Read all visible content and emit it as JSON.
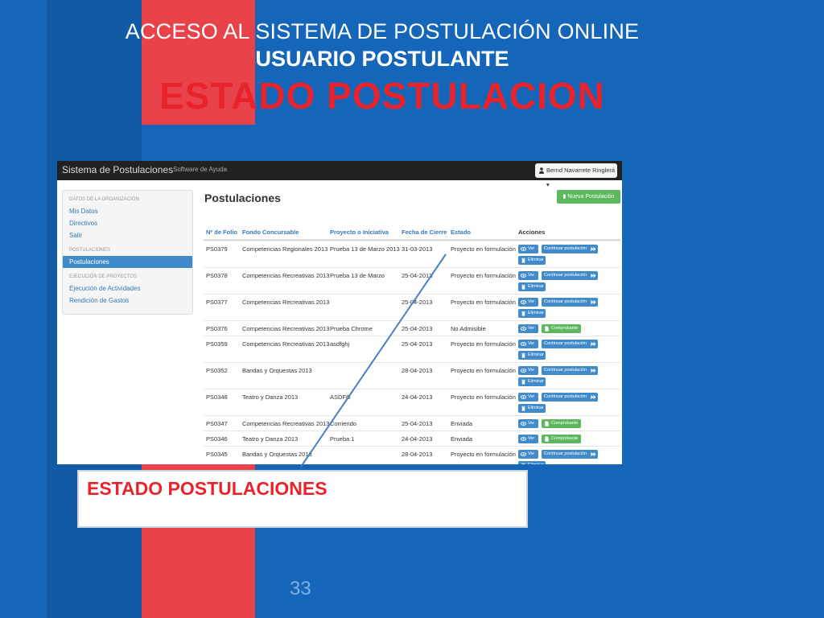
{
  "slide": {
    "title_line1": "ACCESO AL SISTEMA DE POSTULACIÓN ONLINE",
    "title_line2": "USUARIO POSTULANTE",
    "title_line3": "ESTADO POSTULACION",
    "callout": "ESTADO POSTULACIONES",
    "page_number": "33"
  },
  "colors": {
    "slide_bg": "#1565b8",
    "red_band": "#e8434a",
    "title_red": "#e8232b",
    "navbar": "#222222",
    "link_blue": "#337ab7",
    "btn_primary": "#428bca",
    "btn_success": "#5cb85c"
  },
  "app": {
    "brand": "Sistema de Postulaciones",
    "help": "Software de Ayuda",
    "user": "Bernd Navarrete Ringlerá",
    "sidebar": {
      "section1": "DATOS DE LA ORGANIZACIÓN",
      "item_mis_datos": "Mis Datos",
      "item_directivos": "Directivos",
      "item_salir": "Salir",
      "section2": "POSTULACIONES",
      "item_postulaciones": "Postulaciones",
      "section3": "EJECUCIÓN DE PROYECTOS",
      "item_ejecucion": "Ejecución de Actividades",
      "item_rendicion": "Rendición de Gastos"
    },
    "content_title": "Postulaciones",
    "new_button": "Nueva Postulación",
    "table": {
      "headers": {
        "folio": "Nº de Folio",
        "fondo": "Fondo Concursable",
        "proyecto": "Proyecto o Iniciativa",
        "fecha": "Fecha de Cierre",
        "estado": "Estado",
        "acciones": "Acciones"
      },
      "labels": {
        "ver": "Ver",
        "continuar": "Continuar postulación",
        "eliminar": "Eliminar",
        "comprobante": "Comprobante"
      },
      "rows": [
        {
          "folio": "PS0379",
          "fondo": "Competencias Regionales 2013",
          "proyecto": "Prueba 13 de Marzo 2013",
          "fecha": "31-03-2013",
          "estado": "Proyecto en formulación"
        },
        {
          "folio": "PS0378",
          "fondo": "Competencias Recreativas 2013",
          "proyecto": "Prueba 13 de Marzo",
          "fecha": "25-04-2013",
          "estado": "Proyecto en formulación"
        },
        {
          "folio": "PS0377",
          "fondo": "Competencias Recreativas 2013",
          "proyecto": "",
          "fecha": "25-04-2013",
          "estado": "Proyecto en formulación"
        },
        {
          "folio": "PS0376",
          "fondo": "Competencias Recreativas 2013",
          "proyecto": "Prueba Chrome",
          "fecha": "25-04-2013",
          "estado": "No Admisible"
        },
        {
          "folio": "PS0359",
          "fondo": "Competencias Recreativas 2013",
          "proyecto": "asdfghj",
          "fecha": "25-04-2013",
          "estado": "Proyecto en formulación"
        },
        {
          "folio": "PS0352",
          "fondo": "Bandas y Orquestas 2013",
          "proyecto": "",
          "fecha": "28-04-2013",
          "estado": "Proyecto en formulación"
        },
        {
          "folio": "PS0348",
          "fondo": "Teatro y Danza 2013",
          "proyecto": "ASDFG",
          "fecha": "24-04-2013",
          "estado": "Proyecto en formulación"
        },
        {
          "folio": "PS0347",
          "fondo": "Competencias Recreativas 2013",
          "proyecto": "Corriendo",
          "fecha": "25-04-2013",
          "estado": "Enviada"
        },
        {
          "folio": "PS0346",
          "fondo": "Teatro y Danza 2013",
          "proyecto": "Prueba 1",
          "fecha": "24-04-2013",
          "estado": "Enviada"
        },
        {
          "folio": "PS0345",
          "fondo": "Bandas y Orquestas 2013",
          "proyecto": "",
          "fecha": "28-04-2013",
          "estado": "Proyecto en formulación"
        }
      ]
    }
  }
}
